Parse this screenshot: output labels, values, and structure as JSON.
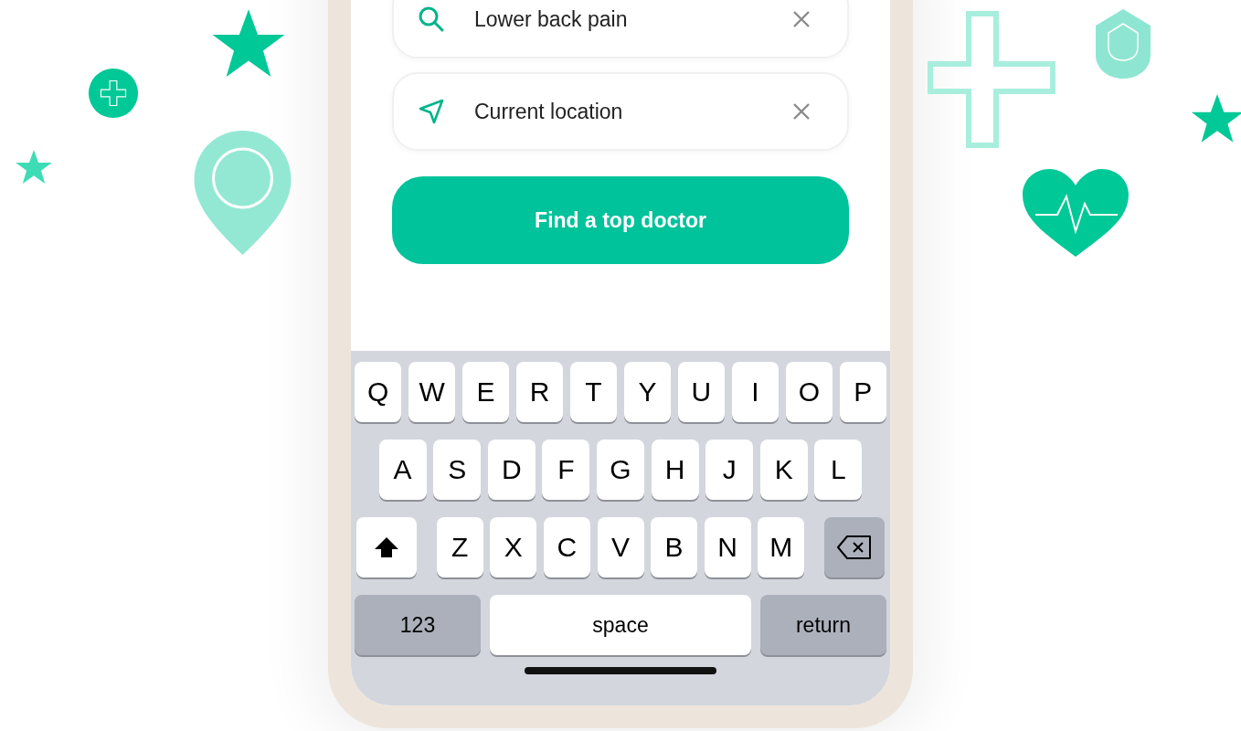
{
  "fields": [
    {
      "kind": "search",
      "value": "Lower back pain"
    },
    {
      "kind": "location",
      "value": "Current location"
    }
  ],
  "button": "Find a top doctor",
  "keyboard": {
    "rows": [
      {
        "keys": [
          {
            "kind": "letter",
            "label": "Q"
          },
          {
            "kind": "letter",
            "label": "W"
          },
          {
            "kind": "letter",
            "label": "E"
          },
          {
            "kind": "letter",
            "label": "R"
          },
          {
            "kind": "letter",
            "label": "T"
          },
          {
            "kind": "letter",
            "label": "Y"
          },
          {
            "kind": "letter",
            "label": "U"
          },
          {
            "kind": "letter",
            "label": "I"
          },
          {
            "kind": "letter",
            "label": "O"
          },
          {
            "kind": "letter",
            "label": "P"
          }
        ]
      },
      {
        "keys": [
          {
            "kind": "letter",
            "label": "A"
          },
          {
            "kind": "letter",
            "label": "S"
          },
          {
            "kind": "letter",
            "label": "D"
          },
          {
            "kind": "letter",
            "label": "F"
          },
          {
            "kind": "letter",
            "label": "G"
          },
          {
            "kind": "letter",
            "label": "H"
          },
          {
            "kind": "letter",
            "label": "J"
          },
          {
            "kind": "letter",
            "label": "K"
          },
          {
            "kind": "letter",
            "label": "L"
          }
        ]
      },
      {
        "keys": [
          {
            "kind": "shift"
          },
          {
            "kind": "letter",
            "label": "Z"
          },
          {
            "kind": "letter",
            "label": "X"
          },
          {
            "kind": "letter",
            "label": "C"
          },
          {
            "kind": "letter",
            "label": "V"
          },
          {
            "kind": "letter",
            "label": "B"
          },
          {
            "kind": "letter",
            "label": "N"
          },
          {
            "kind": "letter",
            "label": "M"
          },
          {
            "kind": "backspace"
          }
        ]
      },
      {
        "keys": [
          {
            "kind": "mode",
            "label": "123"
          },
          {
            "kind": "space",
            "label": "space"
          },
          {
            "kind": "return",
            "label": "return"
          }
        ]
      }
    ]
  }
}
